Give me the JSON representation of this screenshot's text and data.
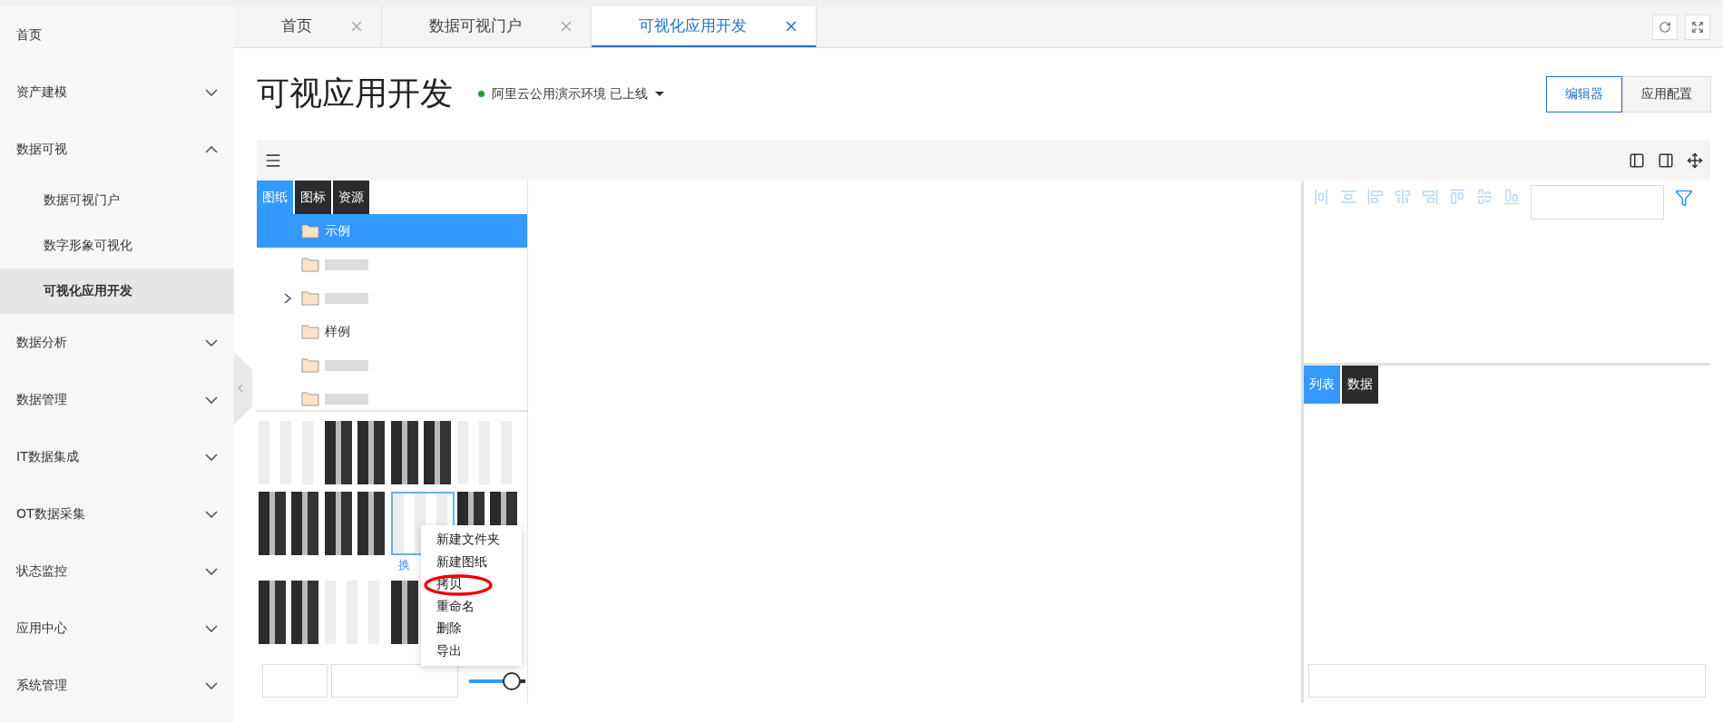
{
  "sidebar": {
    "items": [
      {
        "label": "首页",
        "expanded": false,
        "selected": false
      },
      {
        "label": "资产建模",
        "expanded": false,
        "selected": false
      },
      {
        "label": "数据可视",
        "expanded": true,
        "selected": false,
        "children": [
          {
            "label": "数据可视门户",
            "selected": false
          },
          {
            "label": "数字形象可视化",
            "selected": false
          },
          {
            "label": "可视化应用开发",
            "selected": true
          }
        ]
      },
      {
        "label": "数据分析",
        "expanded": false,
        "selected": false
      },
      {
        "label": "数据管理",
        "expanded": false,
        "selected": false
      },
      {
        "label": "IT数据集成",
        "expanded": false,
        "selected": false
      },
      {
        "label": "OT数据采集",
        "expanded": false,
        "selected": false
      },
      {
        "label": "状态监控",
        "expanded": false,
        "selected": false
      },
      {
        "label": "应用中心",
        "expanded": false,
        "selected": false
      },
      {
        "label": "系统管理",
        "expanded": false,
        "selected": false
      }
    ]
  },
  "tabs": [
    {
      "label": "首页",
      "selected": false
    },
    {
      "label": "数据可视门户",
      "selected": false
    },
    {
      "label": "可视化应用开发",
      "selected": true
    }
  ],
  "header": {
    "title": "可视应用开发",
    "environment": "阿里云公用演示环境 已上线",
    "buttons": [
      {
        "label": "编辑器",
        "selected": true
      },
      {
        "label": "应用配置",
        "selected": false
      }
    ]
  },
  "left_panel": {
    "tabs": [
      {
        "label": "图纸",
        "selected": true
      },
      {
        "label": "图标",
        "selected": false
      },
      {
        "label": "资源",
        "selected": false
      }
    ],
    "tree": [
      {
        "label": "示例",
        "selected": true,
        "expandable": false
      },
      {
        "selected": false,
        "expandable": false
      },
      {
        "selected": false,
        "expandable": true
      },
      {
        "label": "样例",
        "selected": false,
        "expandable": false
      },
      {
        "selected": false,
        "expandable": false
      },
      {
        "selected": false,
        "expandable": false
      }
    ],
    "thumbnails": [
      {
        "selected": false
      },
      {
        "selected": false
      },
      {
        "selected": false
      },
      {
        "selected": false
      },
      {
        "selected": false
      },
      {
        "selected": false
      },
      {
        "selected": true,
        "caption": "换"
      },
      {
        "selected": false
      },
      {
        "selected": false
      },
      {
        "selected": false
      },
      {
        "selected": false
      }
    ],
    "context_menu": [
      "新建文件夹",
      "新建图纸",
      "拷贝",
      "重命名",
      "删除",
      "导出"
    ],
    "zoom_slider": {
      "level": 0.6
    }
  },
  "right_panel": {
    "tabs": [
      {
        "label": "列表",
        "selected": true
      },
      {
        "label": "数据",
        "selected": false
      }
    ]
  }
}
